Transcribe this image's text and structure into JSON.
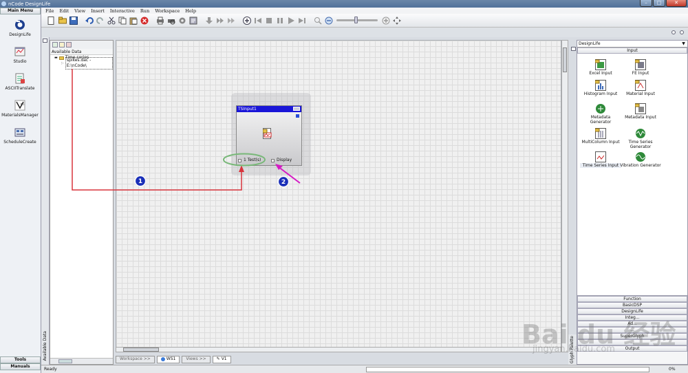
{
  "window": {
    "title": "nCode DesignLife"
  },
  "menu": [
    "File",
    "Edit",
    "View",
    "Insert",
    "Interactive",
    "Run",
    "Workspace",
    "Help"
  ],
  "main_menu": {
    "header": "Main Menu",
    "items": [
      {
        "label": "DesignLife",
        "icon": "designlife-icon"
      },
      {
        "label": "Studio",
        "icon": "studio-icon"
      },
      {
        "label": "ASCIITranslate",
        "icon": "ascii-translate-icon"
      },
      {
        "label": "MaterialsManager",
        "icon": "materials-manager-icon"
      },
      {
        "label": "ScheduleCreate",
        "icon": "schedule-create-icon"
      }
    ],
    "footer": [
      "Tools",
      "Manuals"
    ]
  },
  "available_data": {
    "side_label": "Available Data",
    "title": "Available Data",
    "tree": [
      {
        "label": "Time series"
      },
      {
        "label": "spikes.dac - E:\\nCode\\"
      }
    ]
  },
  "glyph": {
    "title": "TSInput1",
    "port_left": "1 Test(s)",
    "port_right": "Display"
  },
  "annotations": [
    "1",
    "2"
  ],
  "bottom_tabs": [
    {
      "label": "Workspace >>",
      "active": false
    },
    {
      "label": "WS1",
      "active": true
    },
    {
      "label": "Views >>",
      "active": false
    },
    {
      "label": "V1",
      "active": true
    }
  ],
  "palette": {
    "selected": "DesignLife",
    "side_label": "Glyph Palette",
    "open_section": "Input",
    "items": [
      {
        "label": "Excel Input",
        "icon": "excel-input-icon"
      },
      {
        "label": "FE Input",
        "icon": "fe-input-icon"
      },
      {
        "label": "Histogram Input",
        "icon": "histogram-input-icon"
      },
      {
        "label": "Material Input",
        "icon": "material-input-icon"
      },
      {
        "label": "Metadata Generator",
        "icon": "metadata-generator-icon"
      },
      {
        "label": "Metadata Input",
        "icon": "metadata-input-icon"
      },
      {
        "label": "MultiColumn Input",
        "icon": "multicolumn-input-icon"
      },
      {
        "label": "Time Series Generator",
        "icon": "time-series-generator-icon"
      },
      {
        "label": "Time Series Input",
        "icon": "time-series-input-icon"
      },
      {
        "label": "Vibration Generator",
        "icon": "vibration-generator-icon"
      }
    ],
    "sections": [
      "Function",
      "BasicDSP",
      "DesignLife",
      "Integ...",
      "Ad...",
      "...",
      "SuperGlyph",
      "...",
      "Output"
    ]
  },
  "status": {
    "text": "Ready",
    "percent_label": "0%",
    "progress": 0.0
  },
  "watermark": {
    "main": "Bai du 经验",
    "sub": "jingyan.baidu.com"
  },
  "colors": {
    "title_bar": "#50709a",
    "glyph_title": "#1a16d8",
    "arrow_red": "#d8343c",
    "arrow_magenta": "#d51ac4",
    "badge_blue": "#1a2fb8"
  }
}
